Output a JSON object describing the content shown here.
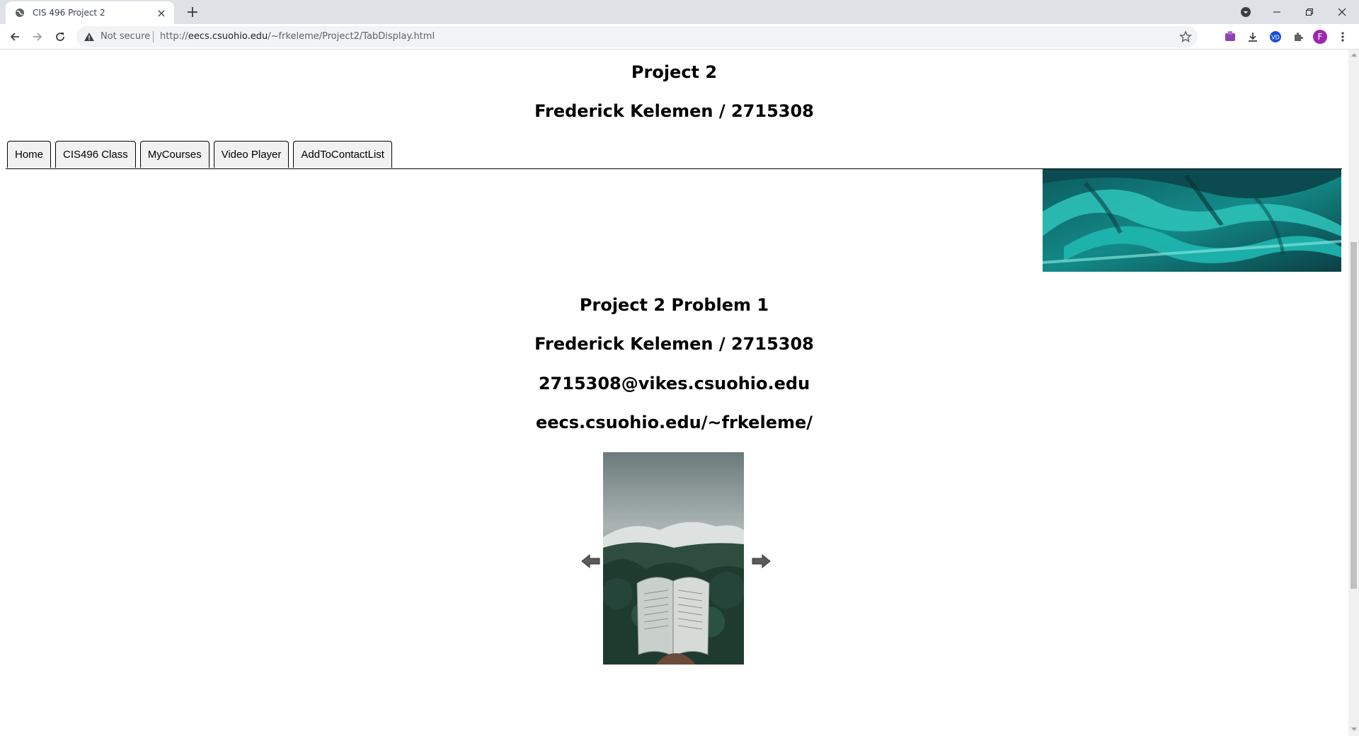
{
  "browser": {
    "tab_title": "CIS 496 Project 2",
    "close_glyph": "×",
    "newtab_glyph": "+",
    "security_label": "Not secure",
    "url_host": "eecs.csuohio.edu",
    "url_prefix": "http://",
    "url_path": "/~frkeleme/Project2/TabDisplay.html",
    "avatar_letter": "F",
    "icons": [
      "globe-icon",
      "back-icon",
      "forward-icon",
      "reload-icon",
      "warning-icon",
      "star-icon",
      "download-icon",
      "puzzle-icon",
      "minimize-icon",
      "restore-icon",
      "close-window-icon",
      "chrome-menu-icon"
    ]
  },
  "page": {
    "title": "Project 2",
    "author_line": "Frederick Kelemen / 2715308",
    "tabs": [
      {
        "label": "Home"
      },
      {
        "label": "CIS496 Class"
      },
      {
        "label": "MyCourses"
      },
      {
        "label": "Video Player"
      },
      {
        "label": "AddToContactList"
      }
    ],
    "content": {
      "heading": "Project 2 Problem 1",
      "author_line": "Frederick Kelemen / 2715308",
      "email": "2715308@vikes.csuohio.edu",
      "website": "eecs.csuohio.edu/~frkeleme/"
    }
  },
  "colors": {
    "banner_teal": "#1fb7b0",
    "banner_dark": "#0a3f44",
    "tab_bg": "#f1f1f1",
    "chrome_bg": "#dee1e6"
  }
}
